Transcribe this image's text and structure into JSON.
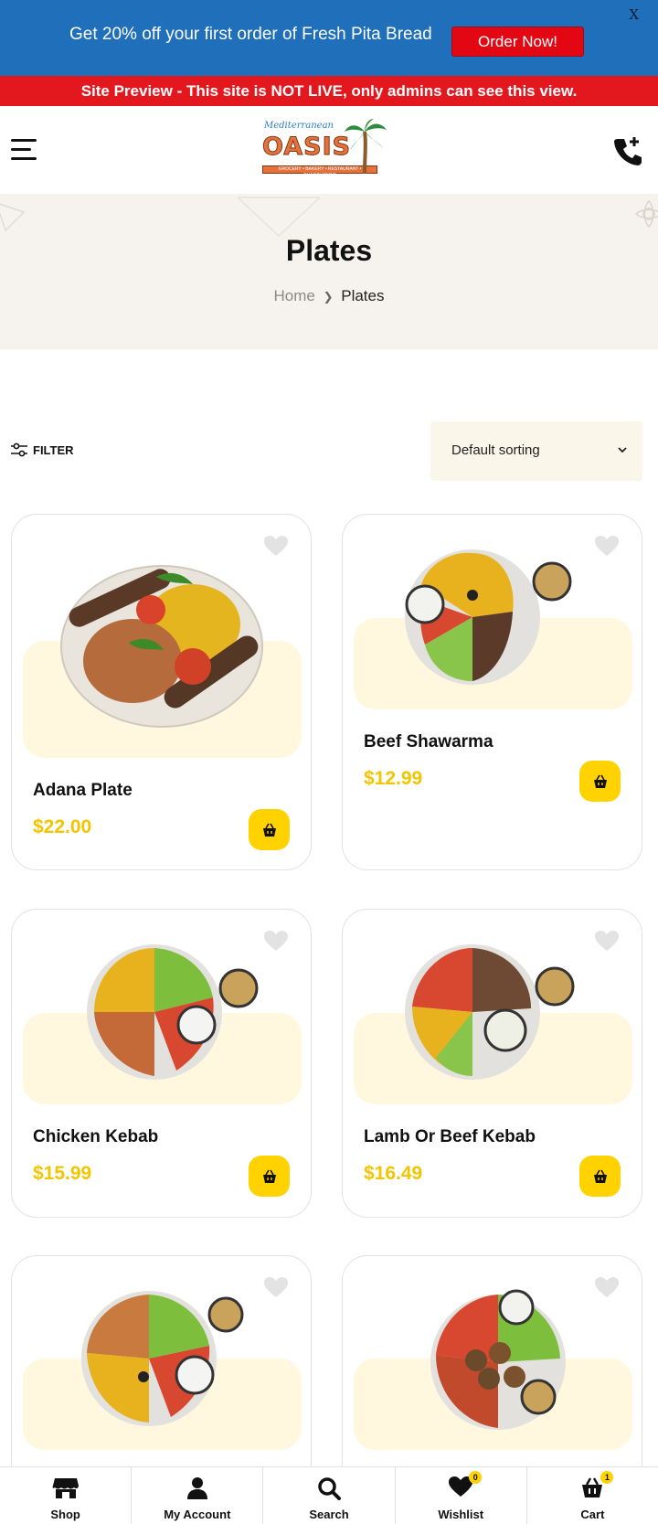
{
  "promo": {
    "text": "Get 20% off your first order of Fresh Pita Bread",
    "button": "Order Now!",
    "close": "X"
  },
  "preview_banner": "Site Preview - This site is NOT LIVE, only admins can see this view.",
  "header": {
    "logo_top": "Mediterranean",
    "logo_main": "OASIS",
    "logo_sub": "GROCERY • BAKERY • RESTAURANT • CHARCUTERIE"
  },
  "page": {
    "title": "Plates",
    "breadcrumb_home": "Home",
    "breadcrumb_sep": "❯",
    "breadcrumb_current": "Plates"
  },
  "toolbar": {
    "filter": "FILTER",
    "sort": "Default sorting"
  },
  "products": [
    {
      "name": "Adana Plate",
      "price": "$22.00"
    },
    {
      "name": "Beef Shawarma",
      "price": "$12.99"
    },
    {
      "name": "Chicken Kebab",
      "price": "$15.99"
    },
    {
      "name": "Lamb Or Beef Kebab",
      "price": "$16.49"
    },
    {
      "name": "",
      "price": ""
    },
    {
      "name": "",
      "price": ""
    }
  ],
  "bottom_nav": [
    {
      "label": "Shop",
      "icon": "store-icon"
    },
    {
      "label": "My Account",
      "icon": "user-icon"
    },
    {
      "label": "Search",
      "icon": "search-icon"
    },
    {
      "label": "Wishlist",
      "icon": "heart-icon",
      "badge": "0"
    },
    {
      "label": "Cart",
      "icon": "basket-icon",
      "badge": "1"
    }
  ],
  "colors": {
    "promo_bg": "#1f6fba",
    "preview_bg": "#e3181e",
    "accent_yellow": "#ffd200",
    "price_yellow": "#f2c500",
    "card_band": "#fff8df",
    "hero_bg": "#f6f3ee"
  }
}
